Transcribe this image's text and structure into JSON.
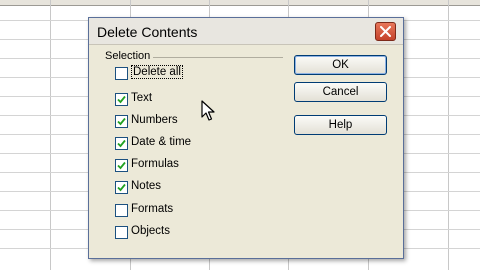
{
  "dialog": {
    "title": "Delete Contents",
    "group_label": "Selection",
    "checkboxes": [
      {
        "label": "Delete all",
        "checked": false
      },
      {
        "label": "Text",
        "checked": true
      },
      {
        "label": "Numbers",
        "checked": true
      },
      {
        "label": "Date & time",
        "checked": true
      },
      {
        "label": "Formulas",
        "checked": true
      },
      {
        "label": "Notes",
        "checked": true
      },
      {
        "label": "Formats",
        "checked": false
      },
      {
        "label": "Objects",
        "checked": false
      }
    ],
    "buttons": {
      "ok": "OK",
      "cancel": "Cancel",
      "help": "Help"
    }
  },
  "colors": {
    "close_button": "#d2543a",
    "checkbox_border": "#1c5180",
    "checkmark": "#21a121"
  }
}
